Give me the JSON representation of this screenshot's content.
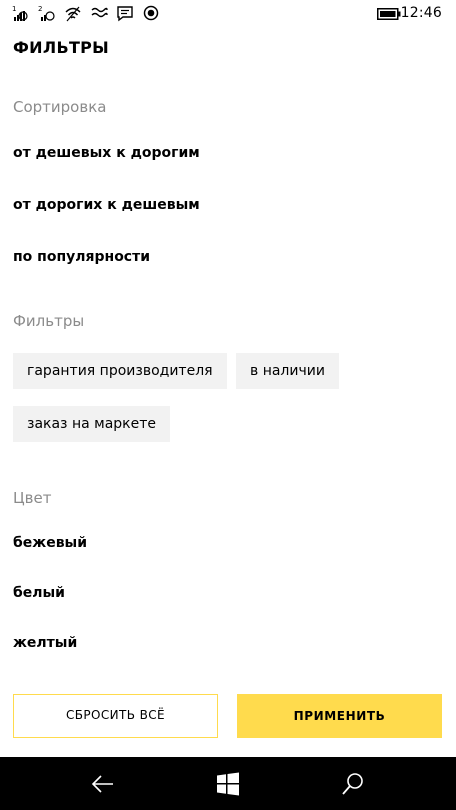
{
  "statusbar": {
    "icons": [
      "signal-1-icon",
      "signal-2-icon",
      "wifi-icon",
      "vibrate-icon",
      "message-icon",
      "location-icon"
    ],
    "time": "12:46"
  },
  "page": {
    "title": "ФИЛЬТРЫ"
  },
  "sort": {
    "label": "Сортировка",
    "options": [
      "от дешевых к дорогим",
      "от дорогих к дешевым",
      "по популярности"
    ]
  },
  "filters": {
    "label": "Фильтры",
    "chips": [
      "гарантия производителя",
      "в наличии",
      "заказ на маркете"
    ]
  },
  "color": {
    "label": "Цвет",
    "options": [
      "бежевый",
      "белый",
      "желтый"
    ]
  },
  "buttons": {
    "reset": "СБРОСИТЬ ВСЁ",
    "apply": "ПРИМЕНИТЬ"
  },
  "colors": {
    "accent": "#ffdb4d",
    "chip_bg": "#f2f2f2",
    "muted_text": "#8b8b8b",
    "navbar": "#000000"
  },
  "navbar": {
    "icons": [
      "back-arrow-icon",
      "windows-logo-icon",
      "search-icon"
    ]
  }
}
